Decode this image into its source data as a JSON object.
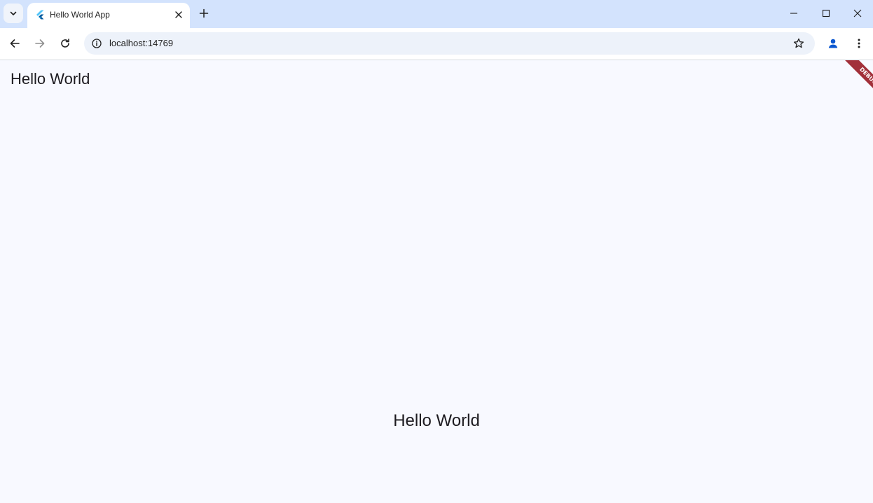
{
  "tab": {
    "title": "Hello World App",
    "favicon": "flutter-logo-icon"
  },
  "address_bar": {
    "url": "localhost:14769"
  },
  "app": {
    "app_bar_title": "Hello World",
    "body_text": "Hello World",
    "debug_banner": "DEBUG"
  },
  "colors": {
    "tabstrip": "#d3e3fd",
    "page_background": "#f8f9ff",
    "debug_banner": "#a2303a",
    "profile_accent": "#0b57d0"
  }
}
